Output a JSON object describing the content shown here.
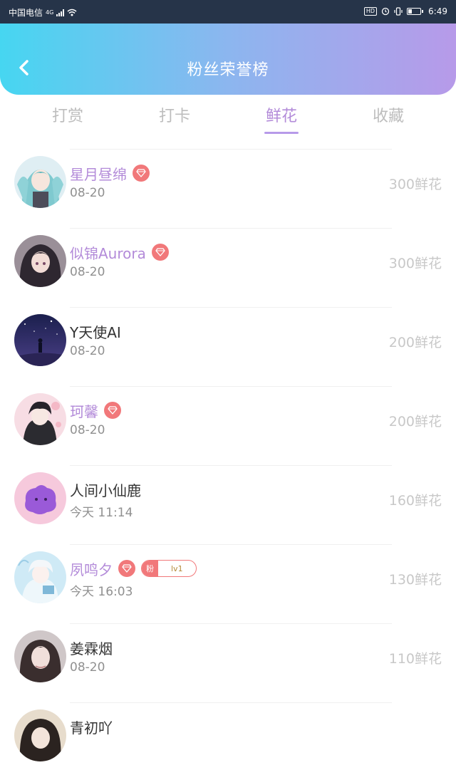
{
  "status_bar": {
    "carrier": "中国电信",
    "network": "4G",
    "time": "6:49",
    "hd_label": "HD"
  },
  "header": {
    "title": "粉丝荣誉榜"
  },
  "tabs": [
    {
      "label": "打赏",
      "active": false
    },
    {
      "label": "打卡",
      "active": false
    },
    {
      "label": "鲜花",
      "active": true
    },
    {
      "label": "收藏",
      "active": false
    }
  ],
  "colors": {
    "accent": "#b38bd9",
    "badge": "#f1787a",
    "header_gradient_start": "#46d6f1",
    "header_gradient_end": "#b79ae9"
  },
  "rows": [
    {
      "name": "星月昼绵",
      "fan": true,
      "diamond": true,
      "level_badge": null,
      "date": "08-20",
      "amount": "300鲜花",
      "avatar": "anime-girl-teal-avatar"
    },
    {
      "name": "似锦Aurora",
      "fan": true,
      "diamond": true,
      "level_badge": null,
      "date": "08-20",
      "amount": "300鲜花",
      "avatar": "anime-girl-dark-avatar"
    },
    {
      "name": "Y天使AI",
      "fan": false,
      "diamond": false,
      "level_badge": null,
      "date": "08-20",
      "amount": "200鲜花",
      "avatar": "night-sky-avatar"
    },
    {
      "name": "珂馨",
      "fan": true,
      "diamond": true,
      "level_badge": null,
      "date": "08-20",
      "amount": "200鲜花",
      "avatar": "anime-boy-avatar"
    },
    {
      "name": "人间小仙鹿",
      "fan": false,
      "diamond": false,
      "level_badge": null,
      "date": "今天 11:14",
      "amount": "160鲜花",
      "avatar": "purple-blob-avatar"
    },
    {
      "name": "夙鸣夕",
      "fan": true,
      "diamond": true,
      "level_badge": {
        "tag": "粉",
        "level": "lv1"
      },
      "date": "今天 16:03",
      "amount": "130鲜花",
      "avatar": "white-hair-boy-avatar"
    },
    {
      "name": "姜霖烟",
      "fan": false,
      "diamond": false,
      "level_badge": null,
      "date": "08-20",
      "amount": "110鲜花",
      "avatar": "girl-photo-avatar"
    },
    {
      "name": "青初吖",
      "fan": false,
      "diamond": false,
      "level_badge": null,
      "date": "",
      "amount": "",
      "avatar": "partial-avatar"
    }
  ]
}
